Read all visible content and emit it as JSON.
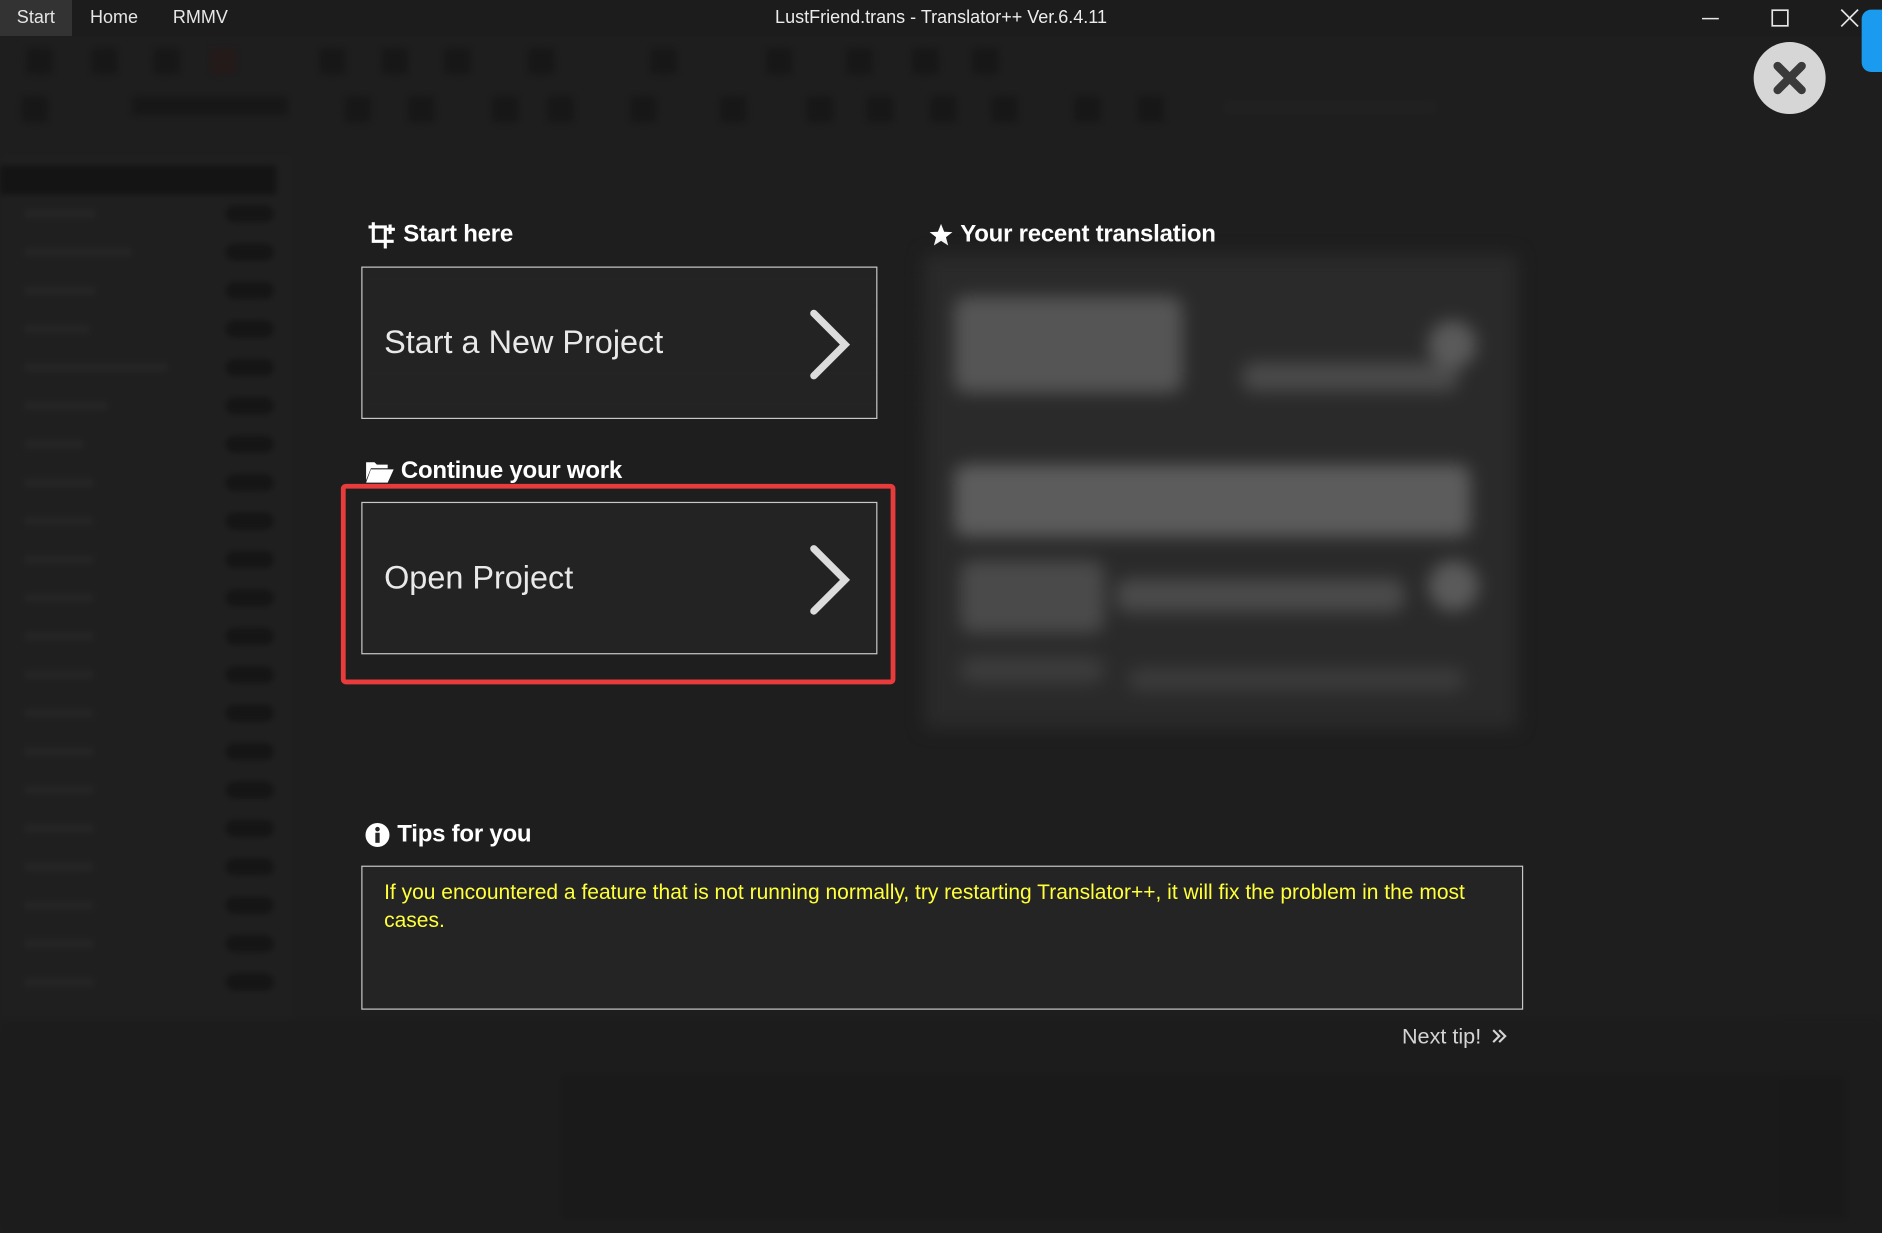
{
  "window": {
    "title": "LustFriend.trans - Translator++ Ver.6.4.11",
    "menu_tabs": [
      "Start",
      "Home",
      "RMMV"
    ],
    "controls": [
      "minimize-icon",
      "maximize-icon",
      "close-icon"
    ]
  },
  "start_panel": {
    "start_here": {
      "heading": "Start here",
      "icon": "crop-plus-icon",
      "button_label": "Start a New Project"
    },
    "continue_work": {
      "heading": "Continue your work",
      "icon": "folder-open-icon",
      "button_label": "Open Project"
    },
    "recent": {
      "heading": "Your recent translation",
      "icon": "star-icon"
    },
    "tips": {
      "heading": "Tips for you",
      "icon": "info-circle-icon",
      "text": "If you encountered a feature that is not running normally, try restarting Translator++, it will fix the problem in the most cases.",
      "next_label": "Next tip!"
    },
    "close_icon": "close-circle-icon"
  },
  "colors": {
    "tip_text": "#ffff3a",
    "highlight": "#e83b3b",
    "accent_tab": "#1a9bf0"
  }
}
